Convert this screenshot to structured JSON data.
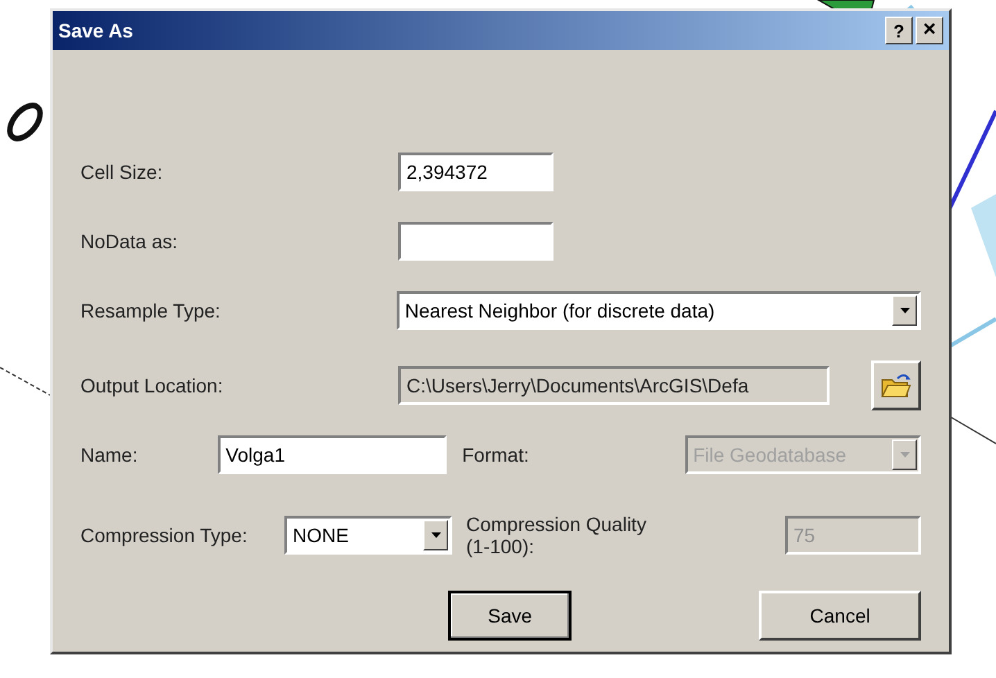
{
  "window": {
    "title": "Save As",
    "help_button": "?",
    "close_button": "×"
  },
  "cell_size": {
    "label": "Cell Size:",
    "value": "2,394372"
  },
  "nodata": {
    "label": "NoData as:"
  },
  "resample": {
    "label": "Resample Type:",
    "value": "Nearest Neighbor (for discrete data)",
    "disabled": false
  },
  "output_location": {
    "label": "Output Location:",
    "value": "C:\\Users\\Jerry\\Documents\\ArcGIS\\Defa",
    "readonly": true
  },
  "name": {
    "label": "Name:",
    "value": "Volga1"
  },
  "format": {
    "label": "Format:",
    "value": "File Geodatabase",
    "disabled": true
  },
  "compression_type": {
    "label": "Compression Type:",
    "value": "NONE",
    "disabled": false
  },
  "compression_quality": {
    "label": "Compression Quality (1-100):",
    "value": "75",
    "disabled": true
  },
  "buttons": [
    {
      "label": "Save",
      "default": true
    },
    {
      "label": "Cancel",
      "default": false
    }
  ]
}
